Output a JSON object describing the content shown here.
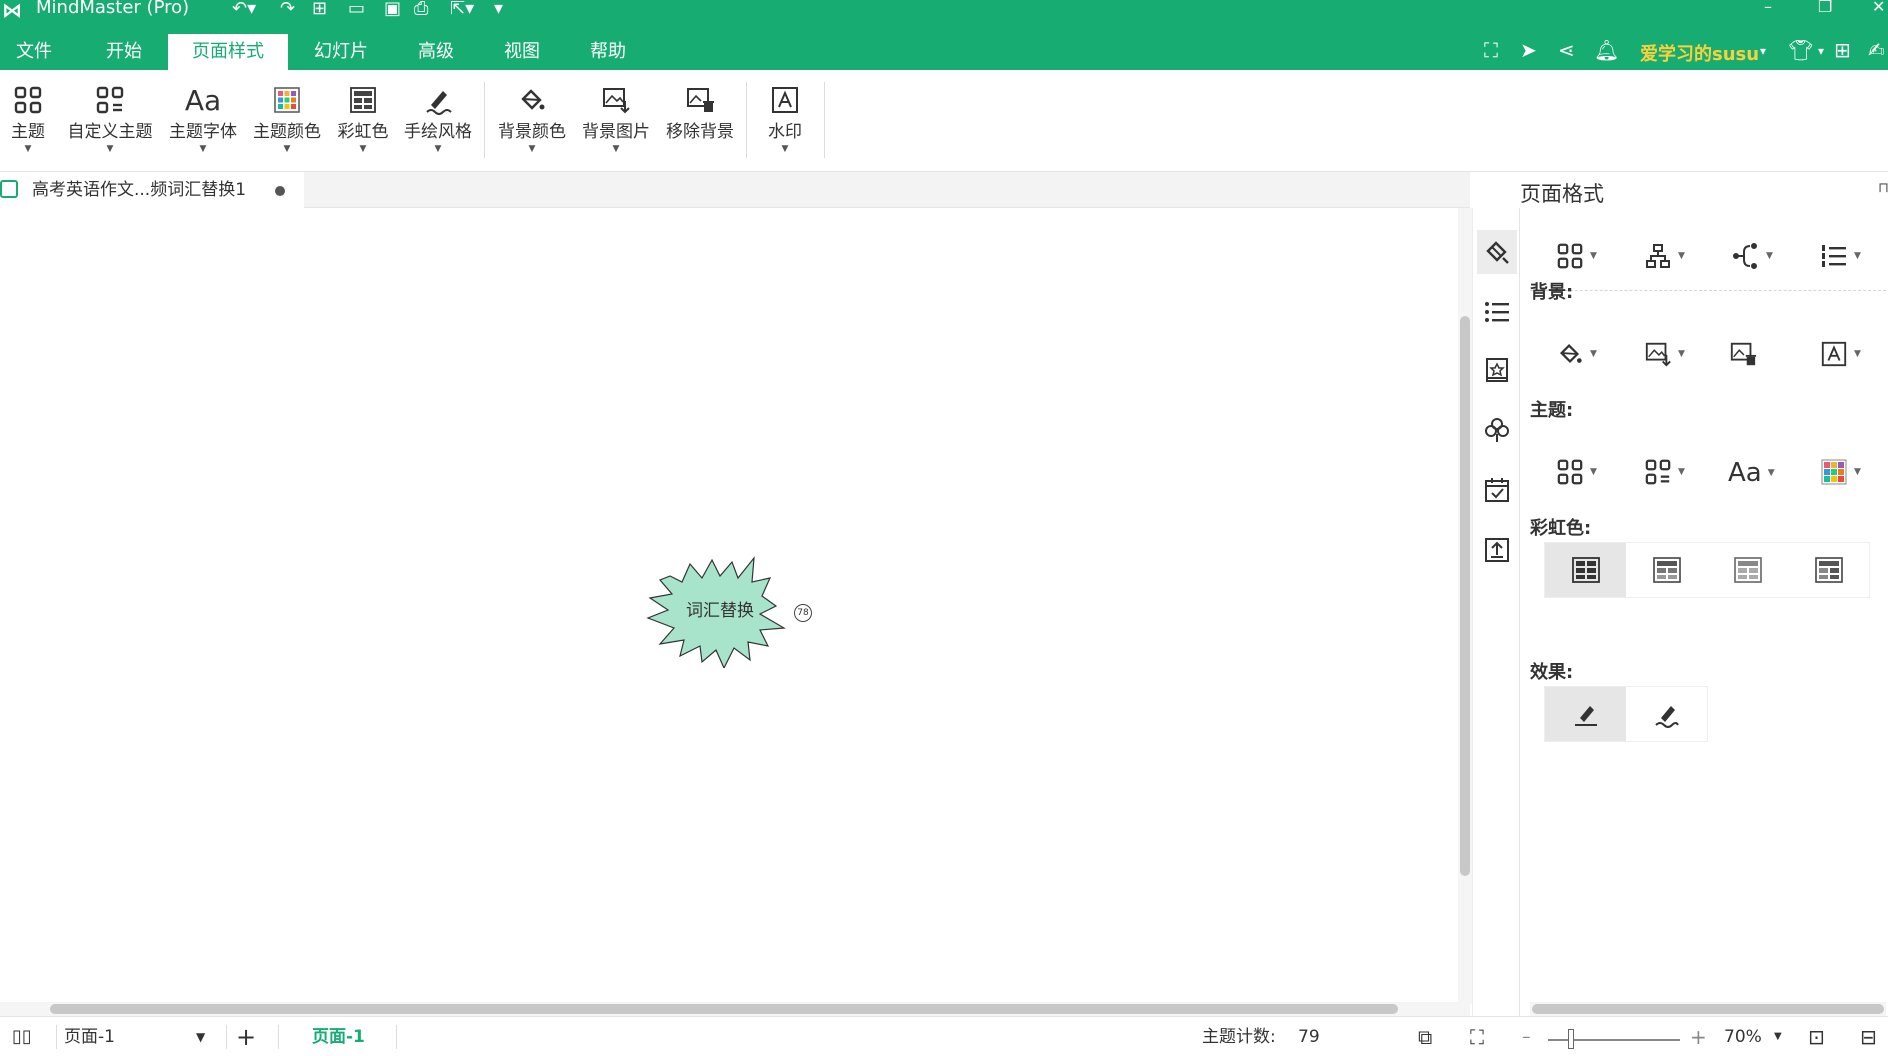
{
  "app": {
    "title": "MindMaster (Pro)"
  },
  "menu": {
    "tabs": [
      "文件",
      "开始",
      "页面样式",
      "幻灯片",
      "高级",
      "视图",
      "帮助"
    ],
    "active": "页面样式"
  },
  "user": {
    "name": "爱学习的susu"
  },
  "ribbon": {
    "theme": "主题",
    "custom_theme": "自定义主题",
    "theme_font": "主题字体",
    "theme_color": "主题颜色",
    "rainbow": "彩虹色",
    "hand_drawn": "手绘风格",
    "bg_color": "背景颜色",
    "bg_image": "背景图片",
    "remove_bg": "移除背景",
    "watermark": "水印",
    "font_glyph": "Aa"
  },
  "document": {
    "tab_title": "高考英语作文...频词汇替换1"
  },
  "canvas": {
    "topic_text": "词汇替换",
    "topic_badge": "78"
  },
  "panel": {
    "title": "页面格式",
    "sections": {
      "background": "背景:",
      "theme": "主题:",
      "rainbow": "彩虹色:",
      "effect": "效果:"
    },
    "font_glyph": "Aa"
  },
  "status": {
    "page_selector": "页面-1",
    "active_page_tab": "页面-1",
    "topic_count_label": "主题计数:",
    "topic_count": "79",
    "zoom": "70%"
  },
  "colors": {
    "brand": "#16ac72",
    "user_name": "#f7d23c",
    "topic_fill": "#a8e4cc"
  }
}
